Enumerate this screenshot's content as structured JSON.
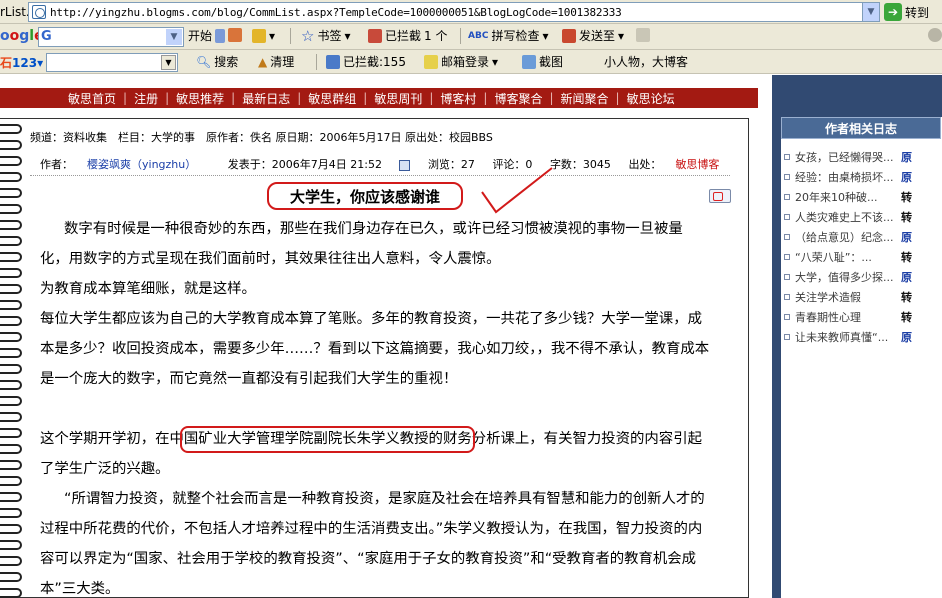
{
  "browser": {
    "address_label": "rList.",
    "url": "http://yingzhu.blogms.com/blog/CommList.aspx?TempleCode=1000000051&BlogLogCode=1001382333",
    "go_label": "转到"
  },
  "google_toolbar": {
    "logo": "oogle",
    "search_g": "G",
    "start_label": "开始",
    "bookmarks_label": "书签",
    "blocked_label": "已拦截",
    "blocked_count": "1 个",
    "spellcheck_label": "拼写检查",
    "sendto_label": "发送至"
  },
  "toolbar_123": {
    "logo": "123",
    "search_label": "搜索",
    "clean_label": "清理",
    "blocked_label": "已拦截:155",
    "mail_label": "邮箱登录",
    "screenshot_label": "截图",
    "slogan": "小人物，大博客"
  },
  "nav": {
    "items": [
      "敏思首页",
      "注册",
      "敏思推荐",
      "最新日志",
      "敏思群组",
      "敏思周刊",
      "博客村",
      "博客聚合",
      "新闻聚合",
      "敏思论坛"
    ]
  },
  "article": {
    "meta_row1": "频道：资料收集　栏目：大学的事　原作者：佚名 原日期：2006年5月17日 原出处：校园BBS",
    "author_label": "作者：",
    "author": "樱姿飒爽（yingzhu）",
    "posted": "发表于：2006年7月4日 21:52",
    "views": "浏览：27",
    "comments": "评论：0",
    "chars": "字数：3045",
    "source_label": "出处：",
    "source": "敏思博客",
    "title": "大学生，你应该感谢谁",
    "p1": "数字有时候是一种很奇妙的东西，那些在我们身边存在已久，或许已经习惯被漠视的事物一旦被量化，用数字的方式呈现在我们面前时，其效果往往出人意料，令人震惊。",
    "p2": "为教育成本算笔细账，就是这样。",
    "p3": "每位大学生都应该为自己的大学教育成本算了笔账。多年的教育投资，一共花了多少钱？大学一堂课，成本是多少？收回投资成本，需要多少年……？看到以下这篇摘要，我心如刀绞，，我不得不承认，教育成本是一个庞大的数字，而它竟然一直都没有引起我们大学生的重视！",
    "p4": "这个学期开学初，在中国矿业大学管理学院副院长朱学义教授的财务分析课上，有关智力投资的内容引起了学生广泛的兴趣。",
    "p5": "“所谓智力投资，就整个社会而言是一种教育投资，是家庭及社会在培养具有智慧和能力的创新人才的过程中所花费的代价，不包括人才培养过程中的生活消费支出。”朱学义教授认为，在我国，智力投资的内容可以界定为“国家、社会用于学校的教育投资”、“家庭用于子女的教育投资”和“受教育者的教育机会成本”三大类。"
  },
  "sidebar": {
    "header": "作者相关日志",
    "items": [
      {
        "title": "女孩，已经懒得哭...",
        "tag": "原"
      },
      {
        "title": "经验：由桌椅损坏...",
        "tag": "原"
      },
      {
        "title": "20年来10种破...",
        "tag": "转"
      },
      {
        "title": "人类灾难史上不该...",
        "tag": "转"
      },
      {
        "title": "（给点意见）纪念...",
        "tag": "原"
      },
      {
        "title": "“八荣八耻”：...",
        "tag": "转"
      },
      {
        "title": "大学，值得多少探...",
        "tag": "原"
      },
      {
        "title": "关注学术造假",
        "tag": "转"
      },
      {
        "title": "青春期性心理",
        "tag": "转"
      },
      {
        "title": "让未来教师真懂“...",
        "tag": "原"
      }
    ]
  },
  "colors": {
    "nav_red": "#a31a12",
    "sidebar_blue": "#314a72",
    "annotation_red": "#d21a1a"
  }
}
